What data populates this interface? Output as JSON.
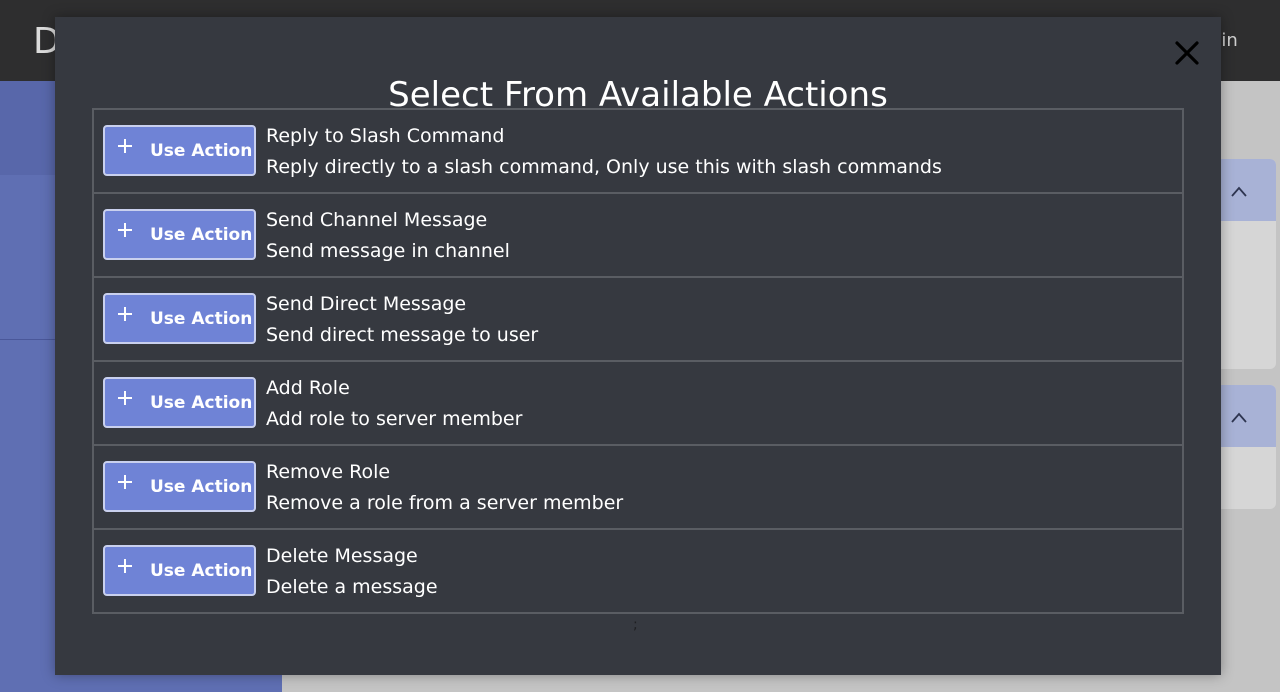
{
  "background": {
    "logo_letter": "D",
    "login_text": "gin"
  },
  "modal": {
    "title": "Select From Available Actions",
    "close_label": "X",
    "actions": [
      {
        "button_label": "Use Action",
        "name": "Reply to Slash Command",
        "description": "Reply directly to a slash command, Only use this with slash commands"
      },
      {
        "button_label": "Use Action",
        "name": "Send Channel Message",
        "description": "Send message in channel"
      },
      {
        "button_label": "Use Action",
        "name": "Send Direct Message",
        "description": "Send direct message to user"
      },
      {
        "button_label": "Use Action",
        "name": "Add Role",
        "description": "Add role to server member"
      },
      {
        "button_label": "Use Action",
        "name": "Remove Role",
        "description": "Remove a role from a server member"
      },
      {
        "button_label": "Use Action",
        "name": "Delete Message",
        "description": "Delete a message"
      }
    ],
    "stray_mark": ";"
  },
  "icons": {
    "close": "close-icon",
    "plus": "plus-icon",
    "chevron": "chevron-up-icon"
  },
  "colors": {
    "modal_bg": "#363940",
    "button_bg": "#6f83d6",
    "left_panel": "#5f6fb3",
    "topbar": "#2e2e2f"
  }
}
